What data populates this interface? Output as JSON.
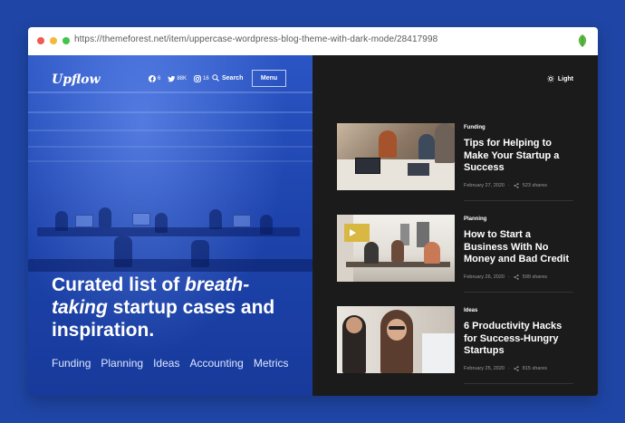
{
  "browser": {
    "url": "https://themeforest.net/item/uppercase-wordpress-blog-theme-with-dark-mode/28417998"
  },
  "site": {
    "logo": "Upflow",
    "social": [
      {
        "icon": "facebook-icon",
        "count": "6"
      },
      {
        "icon": "twitter-icon",
        "count": "88K"
      },
      {
        "icon": "instagram-icon",
        "count": "16"
      }
    ],
    "search_label": "Search",
    "menu_label": "Menu",
    "mode_label": "Light"
  },
  "hero": {
    "headline_1": "Curated list of ",
    "headline_em": "breath-taking",
    "headline_2": " startup cases and inspiration.",
    "categories": [
      "Funding",
      "Planning",
      "Ideas",
      "Accounting",
      "Metrics"
    ]
  },
  "articles": [
    {
      "category": "Funding",
      "title": "Tips for Helping to Make Your Startup a Success",
      "date": "February 27, 2020",
      "shares": "523 shares"
    },
    {
      "category": "Planning",
      "title": "How to Start a Business With No Money and Bad Credit",
      "date": "February 26, 2020",
      "shares": "599 shares"
    },
    {
      "category": "Ideas",
      "title": "6 Productivity Hacks for Success-Hungry Startups",
      "date": "February 25, 2020",
      "shares": "815 shares"
    }
  ],
  "colors": {
    "background": "#1f46a6",
    "hero_blue": "#1e44ad",
    "dark_panel": "#1b1b1b"
  }
}
